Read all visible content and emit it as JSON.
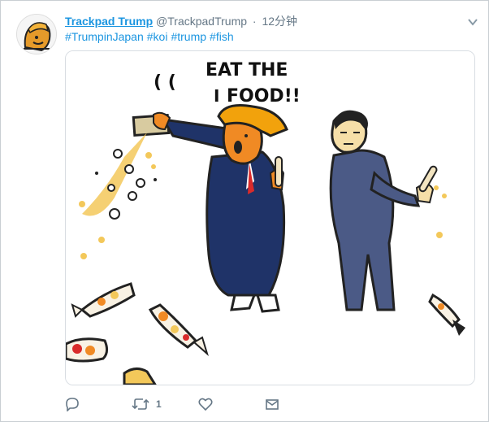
{
  "tweet": {
    "display_name": "Trackpad Trump",
    "handle": "@TrackpadTrump",
    "separator": "·",
    "time": "12分钟",
    "hashtags": [
      "#TrumpinJapan",
      "#koi",
      "#trump",
      "#fish"
    ]
  },
  "media": {
    "caption_line1": "EAT THE",
    "caption_line2": "FOOD!!",
    "quote_mark": "( (",
    "speech_prefix": "I"
  },
  "actions": {
    "reply_icon": "reply-icon",
    "retweet_icon": "retweet-icon",
    "retweet_count": "1",
    "like_icon": "heart-icon",
    "dm_icon": "envelope-icon"
  },
  "colors": {
    "link": "#1b95e0",
    "muted": "#657786",
    "suit_navy": "#1f3368",
    "suit_slate": "#4b5a86",
    "hair_orange": "#f2a20c",
    "fish_food": "#f3c85a"
  }
}
